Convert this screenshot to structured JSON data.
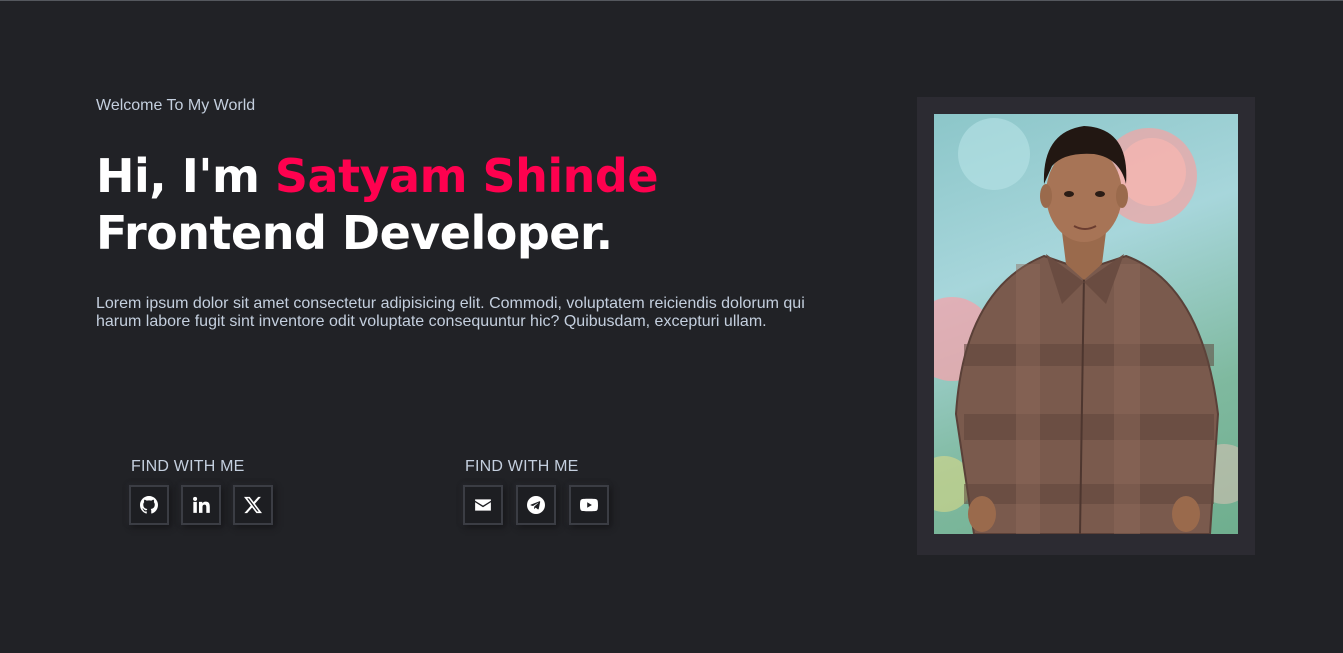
{
  "hero": {
    "welcome": "Welcome To My World",
    "greeting": "Hi, I'm ",
    "name": "Satyam Shinde",
    "role": "Frontend Developer.",
    "description": "Lorem ipsum dolor sit amet consectetur adipisicing elit. Commodi, voluptatem reiciendis dolorum qui harum labore fugit sint inventore odit voluptate consequuntur hic? Quibusdam, excepturi ullam."
  },
  "social_left": {
    "title": "FIND WITH ME",
    "icons": [
      "github-icon",
      "linkedin-icon",
      "x-icon"
    ]
  },
  "social_right": {
    "title": "FIND WITH ME",
    "icons": [
      "envelope-icon",
      "telegram-icon",
      "youtube-icon"
    ]
  },
  "colors": {
    "background": "#212226",
    "accent": "#ff014f",
    "text": "#c4cfde",
    "frame": "#2c2b32"
  }
}
